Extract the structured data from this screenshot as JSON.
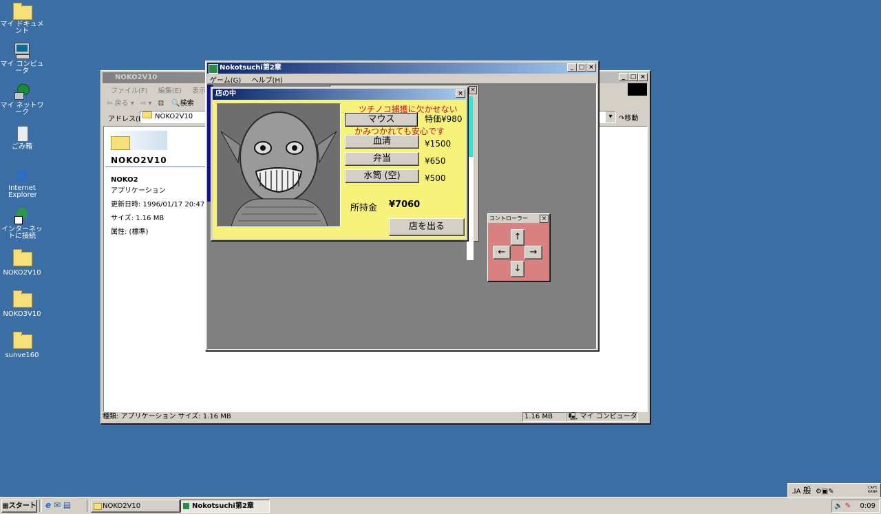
{
  "desktop_icons": [
    {
      "label": "マイ ドキュメント",
      "icon": "folder-docs-icon"
    },
    {
      "label": "マイ コンピュータ",
      "icon": "computer-icon"
    },
    {
      "label": "マイ ネットワーク",
      "icon": "network-icon"
    },
    {
      "label": "ごみ箱",
      "icon": "recycle-bin-icon"
    },
    {
      "label": "Internet Explorer",
      "icon": "ie-icon"
    },
    {
      "label": "インターネットに接続",
      "icon": "connect-icon"
    },
    {
      "label": "NOKO2V10",
      "icon": "folder-icon"
    },
    {
      "label": "NOKO3V10",
      "icon": "folder-icon"
    },
    {
      "label": "sunve160",
      "icon": "folder-icon"
    }
  ],
  "explorer": {
    "title": "NOKO2V10",
    "menu": [
      "ファイル(F)",
      "編集(E)",
      "表示(V)"
    ],
    "back": "戻る",
    "forward": "→",
    "search": "検索",
    "address_label": "アドレス(D)",
    "address": "NOKO2V10",
    "go": "移動",
    "folder_name": "NOKO2V10",
    "file_name": "NOKO2",
    "file_type": "アプリケーション",
    "modified": "更新日時: 1996/01/17 20:47",
    "size": "サイズ: 1.16 MB",
    "attr": "属性: (標準)",
    "status_left": "種類: アプリケーション サイズ: 1.16 MB",
    "status_size": "1.16 MB",
    "status_zone": "マイ コンピュータ"
  },
  "game": {
    "title": "Nokotsuchi第2章",
    "menu": [
      "ゲーム(G)",
      "ヘルプ(H)"
    ]
  },
  "shop": {
    "title": "店の中",
    "slogan1": "ツチノコ捕獲に欠かせない",
    "slogan2": "かみつかれても安心です",
    "items": [
      {
        "label": "マウス",
        "price": "特価¥980"
      },
      {
        "label": "血清",
        "price": "¥1500"
      },
      {
        "label": "弁当",
        "price": "¥650"
      },
      {
        "label": "水筒 (空)",
        "price": "¥500"
      }
    ],
    "money_label": "所持金",
    "money": "¥7060",
    "exit": "店を出る",
    "colors": {
      "bg": "#f7f27a",
      "slogan": "#c8102e"
    }
  },
  "controller": {
    "title": "コントローラー",
    "up": "↑",
    "left": "←",
    "right": "→",
    "down": "↓",
    "bg": "#d98080"
  },
  "taskbar": {
    "start": "スタート",
    "tasks": [
      "NOKO2V10",
      "Nokotsuchi第2章"
    ],
    "clock": "0:09",
    "ime": "般",
    "caps": "CAPS KANA"
  }
}
